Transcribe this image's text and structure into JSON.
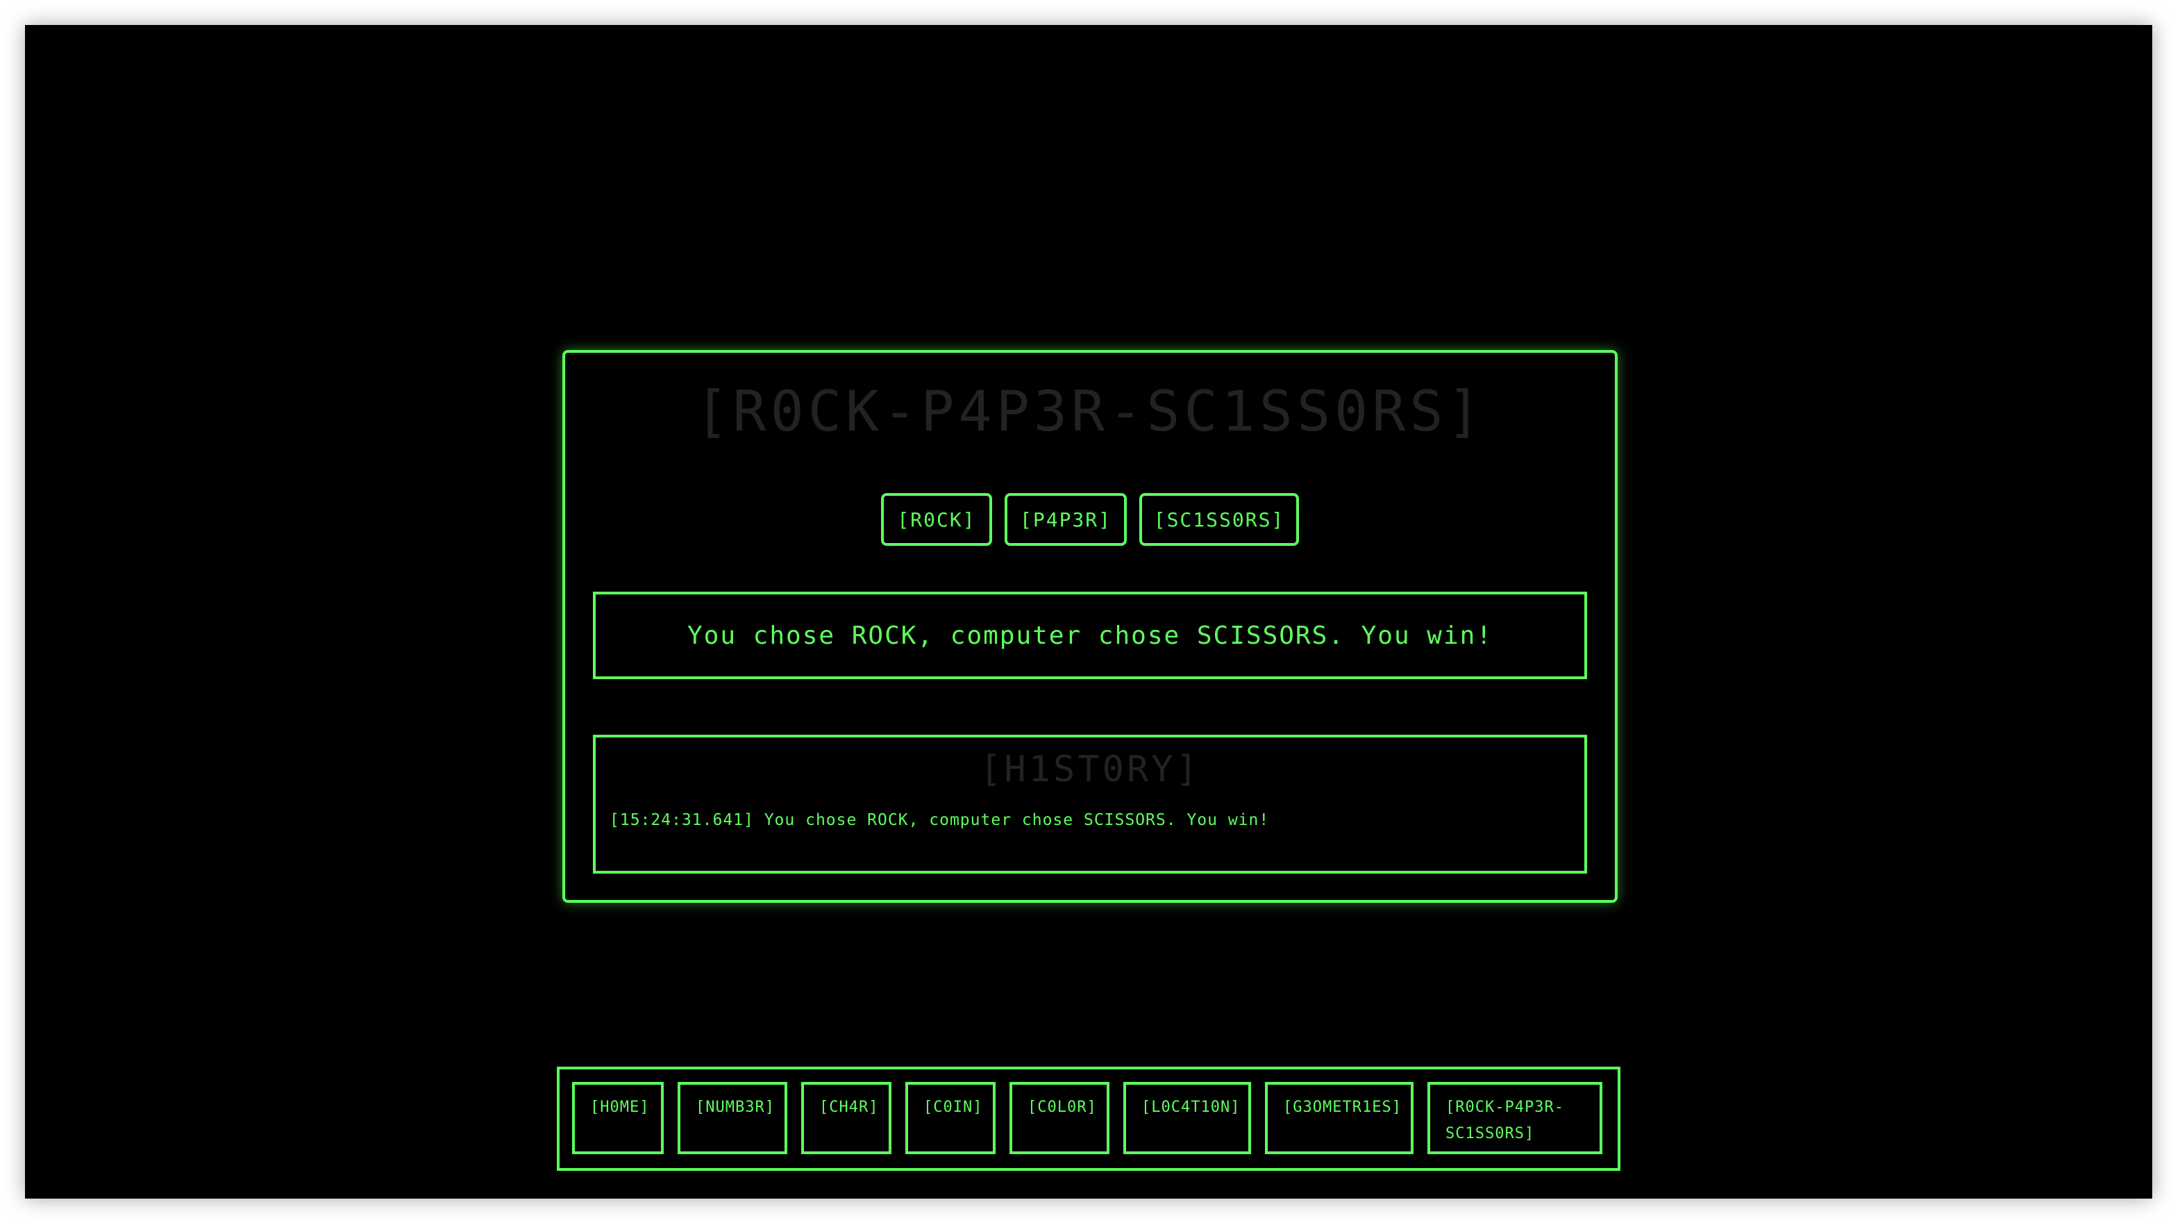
{
  "game": {
    "title": "[R0CK-P4P3R-SC1SS0RS]",
    "choices": [
      {
        "label": "[R0CK]"
      },
      {
        "label": "[P4P3R]"
      },
      {
        "label": "[SC1SS0RS]"
      }
    ],
    "result": "You chose ROCK, computer chose SCISSORS. You win!",
    "history": {
      "title": "[H1ST0RY]",
      "entries": [
        "[15:24:31.641] You chose ROCK, computer chose SCISSORS. You win!"
      ]
    }
  },
  "nav": {
    "items": [
      {
        "label": "[H0ME]"
      },
      {
        "label": "[NUMB3R]"
      },
      {
        "label": "[CH4R]"
      },
      {
        "label": "[C0IN]"
      },
      {
        "label": "[C0L0R]"
      },
      {
        "label": "[L0C4T10N]"
      },
      {
        "label": "[G3OMETR1ES]"
      },
      {
        "label": "[R0CK-P4P3R-SC1SS0RS]"
      }
    ]
  },
  "colors": {
    "accent": "#5dff5d",
    "background": "#000000",
    "dim_text": "#222222"
  }
}
